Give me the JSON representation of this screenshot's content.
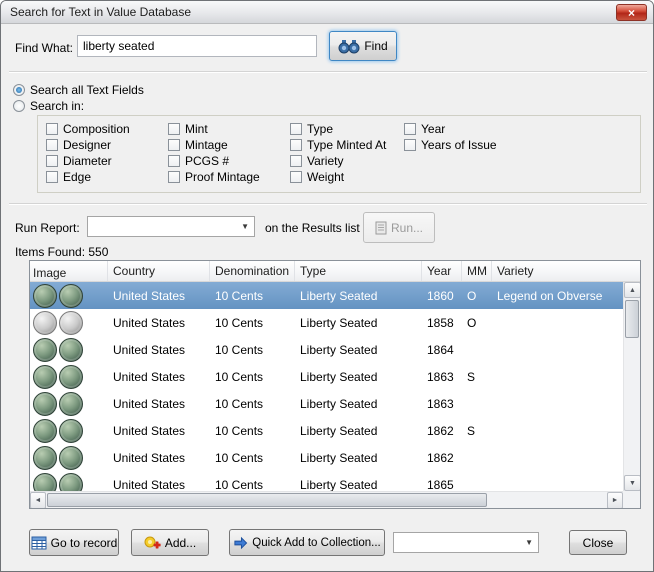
{
  "window": {
    "title": "Search for Text in Value Database",
    "close_glyph": "×"
  },
  "search": {
    "find_label": "Find What:",
    "find_value": "liberty seated",
    "find_button": "Find"
  },
  "scope": {
    "all_fields": "Search all Text Fields",
    "search_in": "Search in:",
    "cols": [
      [
        "Composition",
        "Designer",
        "Diameter",
        "Edge"
      ],
      [
        "Mint",
        "Mintage",
        "PCGS #",
        "Proof Mintage"
      ],
      [
        "Type",
        "Type Minted At",
        "Variety",
        "Weight"
      ],
      [
        "Year",
        "Years of Issue"
      ]
    ]
  },
  "report": {
    "label": "Run Report:",
    "suffix": "on the Results list",
    "run_button": "Run..."
  },
  "results": {
    "items_found_label": "Items Found:",
    "items_found_count": "550",
    "columns": [
      "Image",
      "Country",
      "Denomination",
      "Type",
      "Year",
      "MM",
      "Variety"
    ],
    "rows": [
      {
        "country": "United States",
        "denomination": "10 Cents",
        "type": "Liberty Seated",
        "year": "1860",
        "mm": "O",
        "variety": "Legend on Obverse"
      },
      {
        "country": "United States",
        "denomination": "10 Cents",
        "type": "Liberty Seated",
        "year": "1858",
        "mm": "O",
        "variety": ""
      },
      {
        "country": "United States",
        "denomination": "10 Cents",
        "type": "Liberty Seated",
        "year": "1864",
        "mm": "",
        "variety": ""
      },
      {
        "country": "United States",
        "denomination": "10 Cents",
        "type": "Liberty Seated",
        "year": "1863",
        "mm": "S",
        "variety": ""
      },
      {
        "country": "United States",
        "denomination": "10 Cents",
        "type": "Liberty Seated",
        "year": "1863",
        "mm": "",
        "variety": ""
      },
      {
        "country": "United States",
        "denomination": "10 Cents",
        "type": "Liberty Seated",
        "year": "1862",
        "mm": "S",
        "variety": ""
      },
      {
        "country": "United States",
        "denomination": "10 Cents",
        "type": "Liberty Seated",
        "year": "1862",
        "mm": "",
        "variety": ""
      },
      {
        "country": "United States",
        "denomination": "10 Cents",
        "type": "Liberty Seated",
        "year": "1865",
        "mm": "",
        "variety": ""
      }
    ]
  },
  "footer": {
    "goto_button": "Go to record",
    "add_button": "Add...",
    "quick_add_button": "Quick Add to Collection...",
    "close_button": "Close"
  },
  "colors": {
    "selection_blue": "#6d9ac9",
    "close_red": "#c23b2a",
    "coin_green": "#4e6a58",
    "coin_silver": "#b5b5b5"
  }
}
